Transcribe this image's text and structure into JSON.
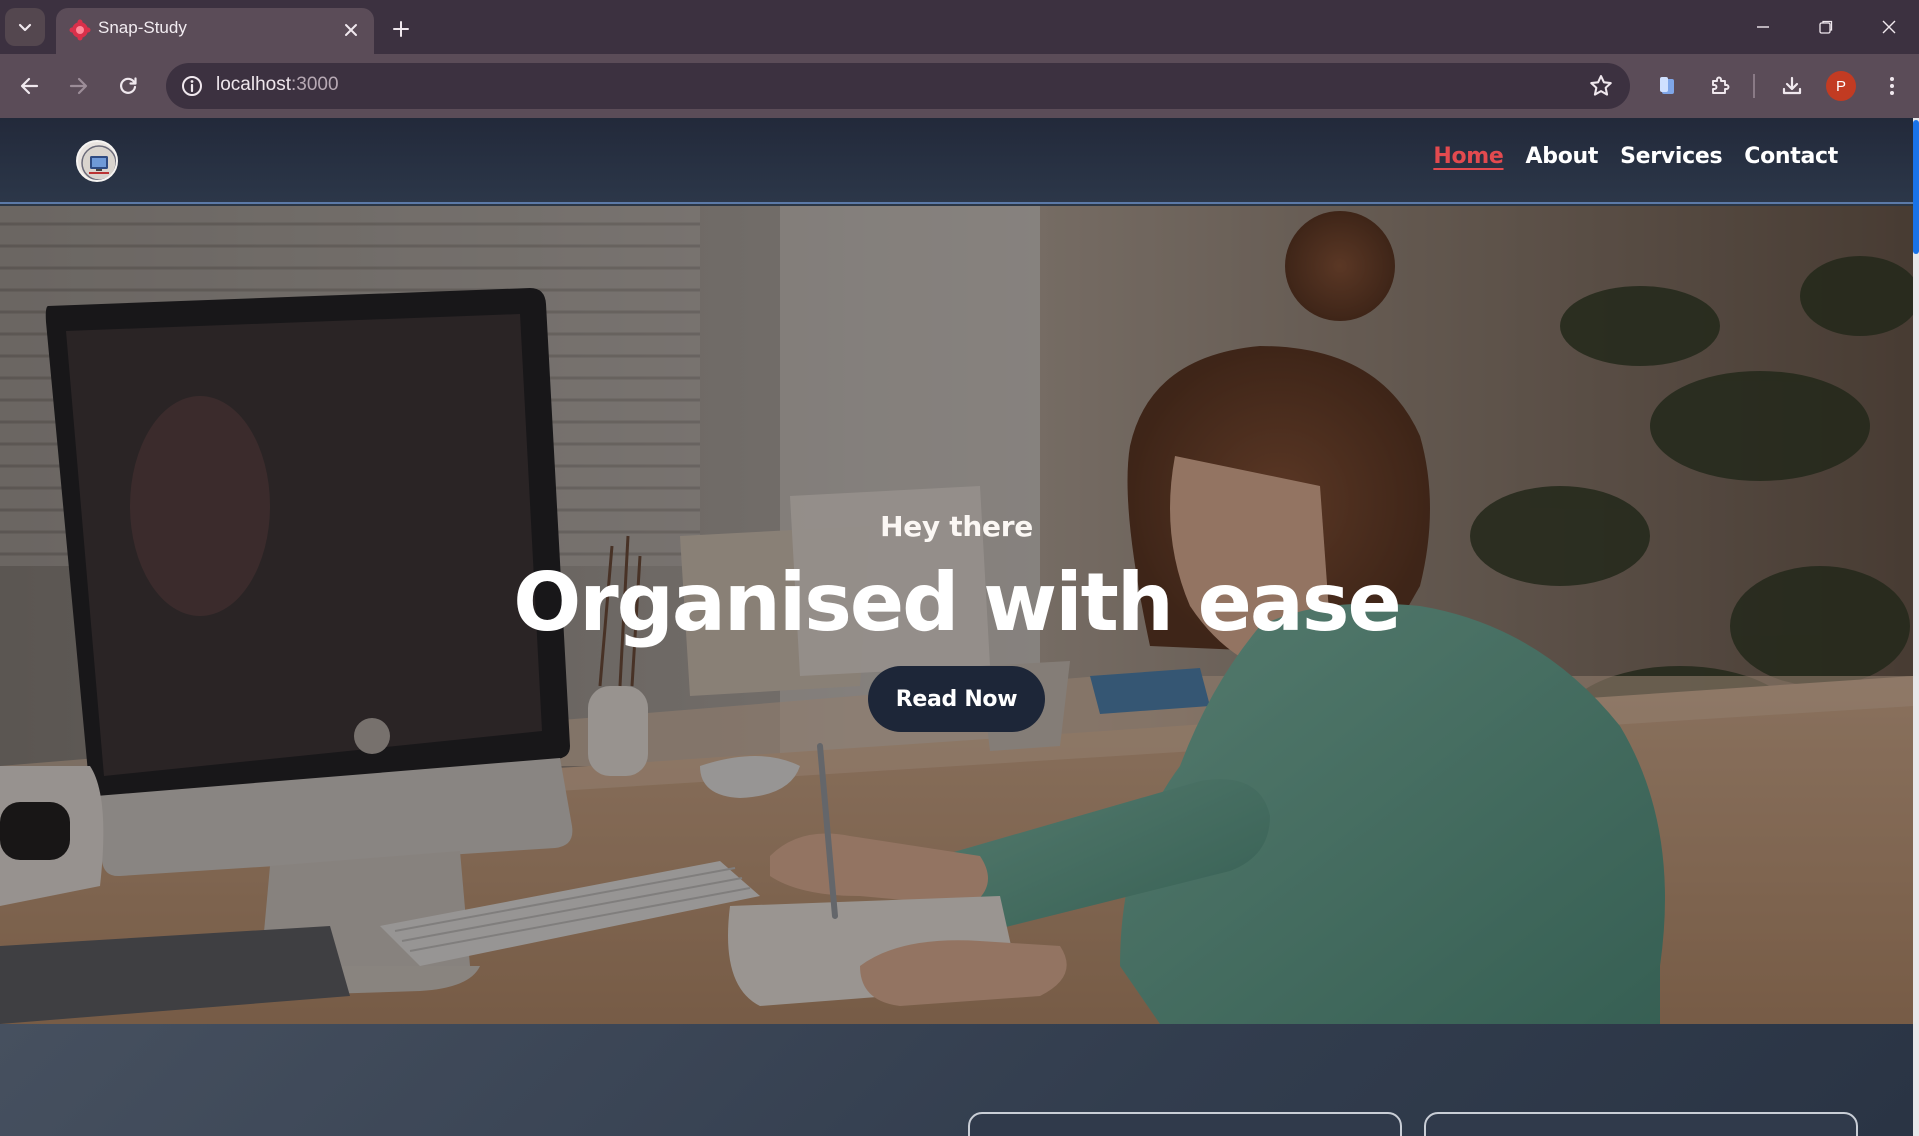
{
  "browser": {
    "tab": {
      "title": "Snap-Study"
    },
    "address": {
      "host": "localhost",
      "port": ":3000"
    },
    "profile_initial": "P"
  },
  "nav": {
    "links": [
      {
        "label": "Home",
        "active": true
      },
      {
        "label": "About",
        "active": false
      },
      {
        "label": "Services",
        "active": false
      },
      {
        "label": "Contact",
        "active": false
      }
    ]
  },
  "hero": {
    "subtitle": "Hey there",
    "title": "Organised with ease",
    "button_label": "Read Now"
  },
  "colors": {
    "nav_bg": "#252e3f",
    "active_link": "#e34a4f",
    "button_bg": "#1d2638",
    "browser_accent": "#5b4c58"
  }
}
